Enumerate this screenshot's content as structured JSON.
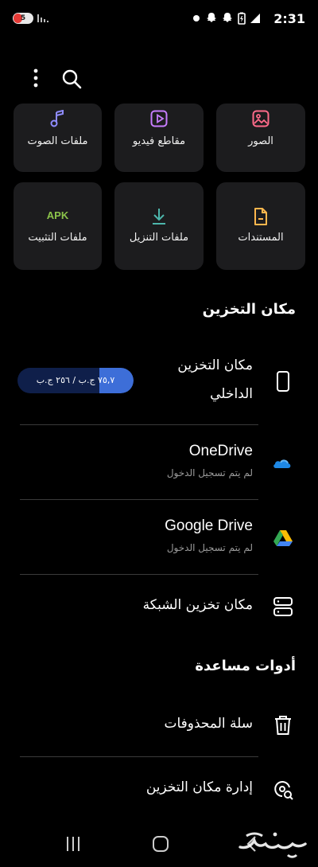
{
  "status_bar": {
    "battery_level": "5",
    "time": "2:31",
    "icons": [
      "wifi-icon",
      "snapchat-icon",
      "snapchat-icon",
      "battery-saver-icon",
      "signal-icon"
    ]
  },
  "toolbar": {
    "icons": [
      "more-options-icon",
      "search-icon"
    ]
  },
  "categories": [
    {
      "label": "ملفات الصوت",
      "icon": "music-note-icon",
      "color": "#8f8cff"
    },
    {
      "label": "مقاطع فيديو",
      "icon": "play-icon",
      "color": "#c77dff"
    },
    {
      "label": "الصور",
      "icon": "image-icon",
      "color": "#ff6b8a"
    },
    {
      "label": "ملفات التثبيت",
      "icon": "apk-icon",
      "icon_text": "APK",
      "color": "#8bc34a"
    },
    {
      "label": "ملفات التنزيل",
      "icon": "download-icon",
      "color": "#4db6ac"
    },
    {
      "label": "المستندات",
      "icon": "document-icon",
      "color": "#ffb74d"
    }
  ],
  "storage_section": {
    "title": "مكان التخزين",
    "internal": {
      "title_line1": "مكان التخزين",
      "title_line2": "الداخلي",
      "usage_text": "٧٥,٧ ج.ب / ٢٥٦ ج.ب",
      "used_fraction": 0.296
    },
    "onedrive": {
      "title": "OneDrive",
      "subtitle": "لم يتم تسجيل الدخول"
    },
    "google_drive": {
      "title": "Google Drive",
      "subtitle": "لم يتم تسجيل الدخول"
    },
    "network": {
      "title": "مكان تخزين الشبكة"
    }
  },
  "tools_section": {
    "title": "أدوات مساعدة",
    "trash": {
      "title": "سلة المحذوفات"
    },
    "manage": {
      "title": "إدارة مكان التخزين"
    }
  },
  "colors": {
    "background": "#000000",
    "tile": "#1c1c1e",
    "accent_blue": "#3d6ed8"
  },
  "watermark_text": "حراج"
}
